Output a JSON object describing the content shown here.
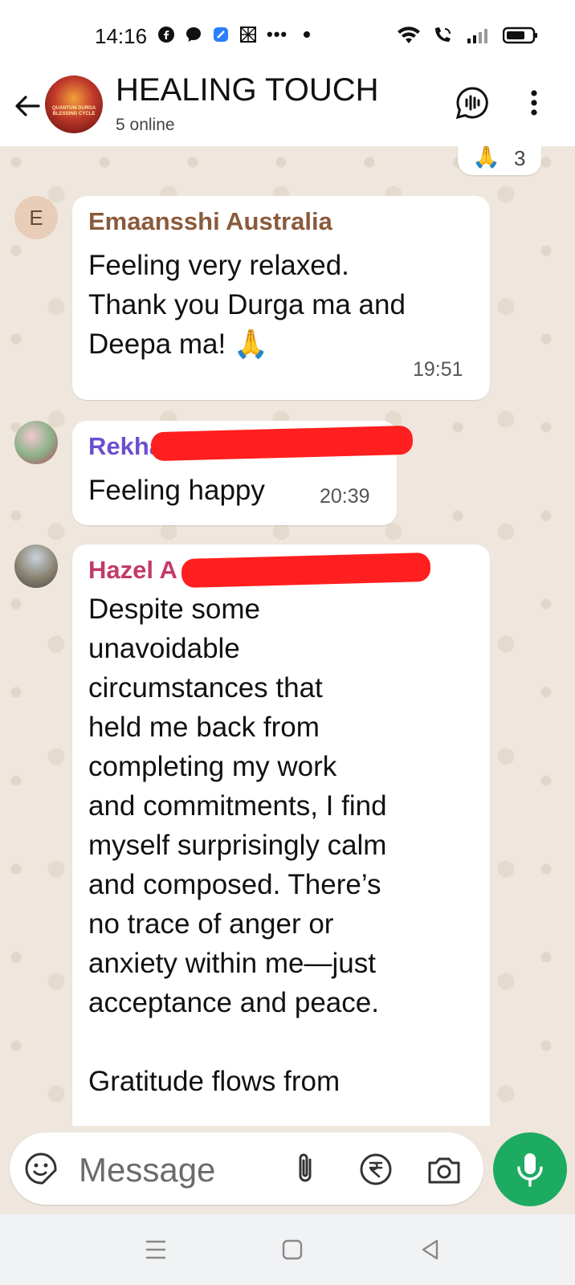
{
  "status_bar": {
    "time": "14:16",
    "dots": "•••"
  },
  "header": {
    "title": "HEALING TOUCH",
    "subtitle": "5 online",
    "avatar_text": "QUANTUM DURGA BLESSING CYCLE"
  },
  "reaction": {
    "emoji": "🙏",
    "count": "3"
  },
  "messages": [
    {
      "sender_initial": "E",
      "sender": "Emaansshi Australia",
      "sender_color": "#8a5a3c",
      "text": "Feeling very relaxed.\nThank you Durga ma and\nDeepa ma! 🙏",
      "time": "19:51"
    },
    {
      "sender": "Rekha P",
      "sender_color": "#6a4fd1",
      "text": "Feeling happy",
      "time": "20:39"
    },
    {
      "sender": "Hazel A",
      "sender_color": "#c23a6b",
      "text": "Despite some\nunavoidable\ncircumstances that\nheld me back from\ncompleting my work\nand commitments, I find\nmyself surprisingly calm\nand composed. There’s\nno trace of anger or\nanxiety within me—just\nacceptance and peace.\n\nGratitude flows from"
    }
  ],
  "composer": {
    "placeholder": "Message"
  },
  "colors": {
    "accent": "#1daa61",
    "chat_background": "#efe7dd",
    "redaction": "#ff1f1f"
  }
}
